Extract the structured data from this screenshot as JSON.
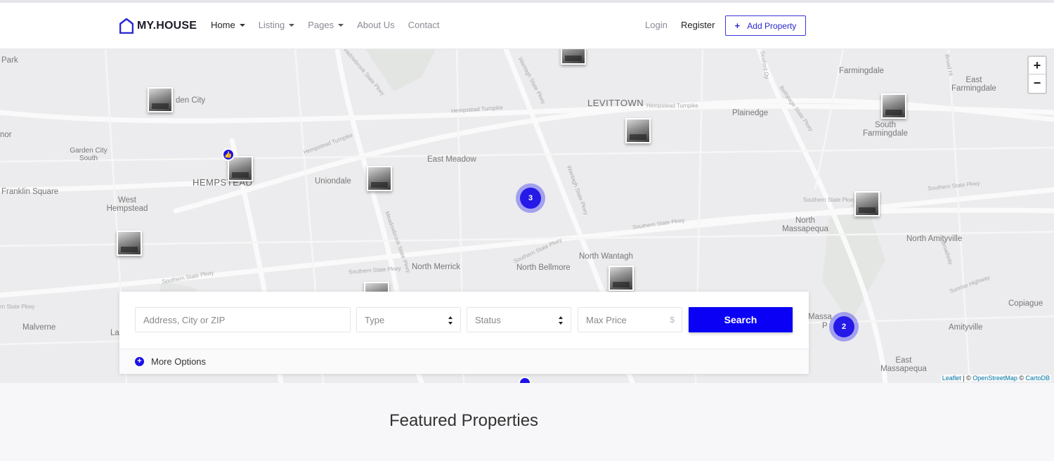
{
  "header": {
    "brand": "MY.HOUSE",
    "nav": [
      {
        "label": "Home",
        "dropdown": true,
        "active": true
      },
      {
        "label": "Listing",
        "dropdown": true,
        "active": false
      },
      {
        "label": "Pages",
        "dropdown": true,
        "active": false
      },
      {
        "label": "About Us",
        "dropdown": false,
        "active": false
      },
      {
        "label": "Contact",
        "dropdown": false,
        "active": false
      }
    ],
    "login": "Login",
    "register": "Register",
    "add_property": "Add Property",
    "brand_color": "#2b28d0"
  },
  "map": {
    "places": [
      "Park",
      "LEVITTOWN",
      "Farmingdale",
      "East Farmingdale",
      "Plainedge",
      "South Farmingdale",
      "Garden City South",
      "Franklin Square",
      "West Hempstead",
      "HEMPSTEAD",
      "Uniondale",
      "East Meadow",
      "North Massapequa",
      "North Amityville",
      "North Wantagh",
      "North Merrick",
      "North Bellmore",
      "Copiague",
      "Amityville",
      "Malverne",
      "East Massapequa",
      "nor",
      "den City",
      "La",
      "Massa",
      "P"
    ],
    "roads": [
      "Hempstead Turnpike",
      "Southern State Pkwy",
      "Wantagh State Pkwy",
      "Meadowbrook State Pkwy",
      "Seaford Oy",
      "Bethpage State Pkwy",
      "Broad Hi",
      "Sunrise Highway",
      "Broadway",
      "rn State Pkwy"
    ],
    "clusters": [
      {
        "count": "3"
      },
      {
        "count": "2"
      }
    ],
    "zoom_in": "+",
    "zoom_out": "−",
    "attribution": {
      "leaflet": "Leaflet",
      "sep1": " | © ",
      "osm": "OpenStreetMap",
      "sep2": " © ",
      "carto": "CartoDB"
    }
  },
  "search": {
    "address_placeholder": "Address, City or ZIP",
    "type_placeholder": "Type",
    "status_placeholder": "Status",
    "max_price_placeholder": "Max Price",
    "currency_symbol": "$",
    "search_button": "Search",
    "more_options": "More Options",
    "button_color": "#0a00f5"
  },
  "featured_title": "Featured Properties"
}
